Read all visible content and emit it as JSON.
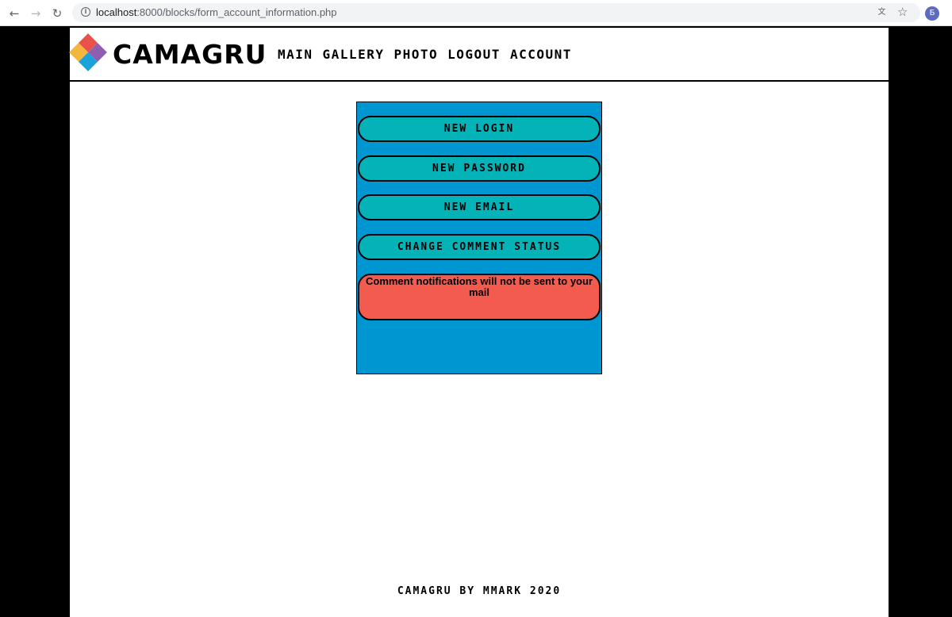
{
  "browser": {
    "url_host": "localhost",
    "url_path": ":8000/blocks/form_account_information.php",
    "translate_icon": "translate-icon",
    "bookmark_icon": "star-icon",
    "profile_initial": "Б"
  },
  "header": {
    "logo_text": "CAMAGRU",
    "nav": [
      "MAIN",
      "GALLERY",
      "PHOTO",
      "LOGOUT",
      "ACCOUNT"
    ]
  },
  "form": {
    "buttons": [
      "NEW LOGIN",
      "NEW PASSWORD",
      "NEW EMAIL",
      "CHANGE COMMENT STATUS"
    ],
    "status_message": "Comment notifications will not be sent to your mail"
  },
  "footer": {
    "text": "CAMAGRU BY MMARK 2020"
  },
  "colors": {
    "panel": "#0096d2",
    "button": "#03b3b8",
    "status": "#f25b4e"
  }
}
